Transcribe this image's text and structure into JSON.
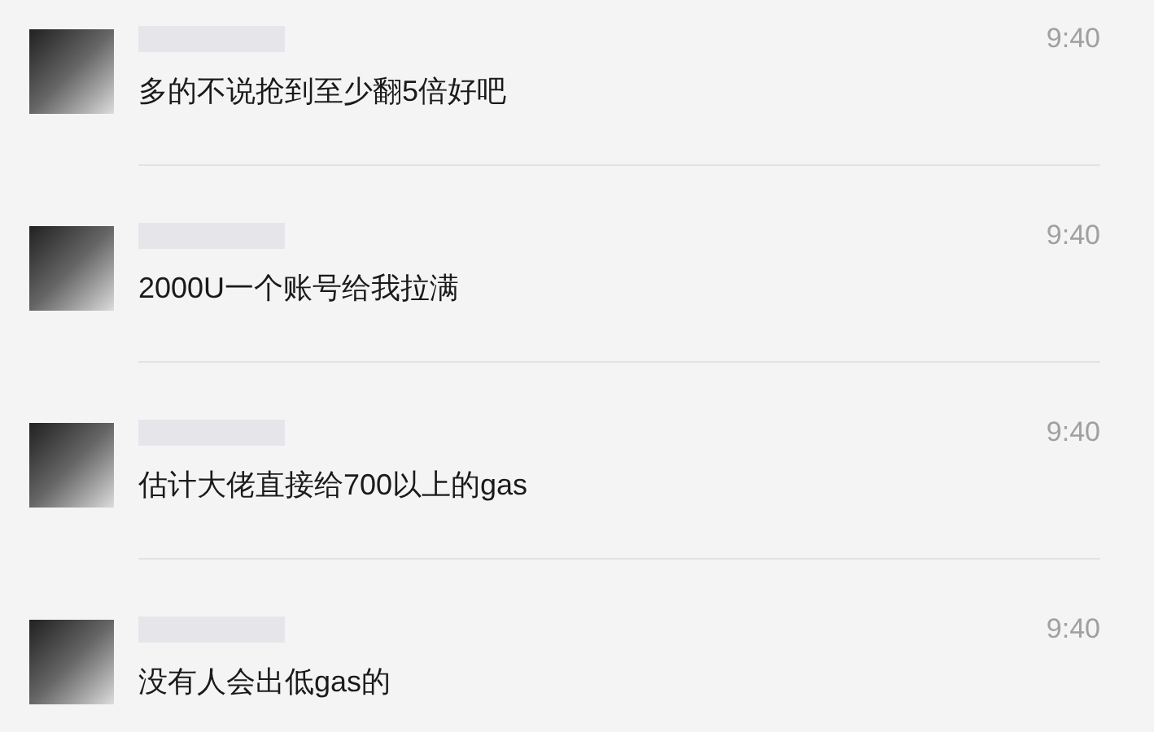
{
  "messages": [
    {
      "time": "9:40",
      "text": "多的不说抢到至少翻5倍好吧"
    },
    {
      "time": "9:40",
      "text": "2000U一个账号给我拉满"
    },
    {
      "time": "9:40",
      "text": "估计大佬直接给700以上的gas"
    },
    {
      "time": "9:40",
      "text": "没有人会出低gas的"
    }
  ]
}
